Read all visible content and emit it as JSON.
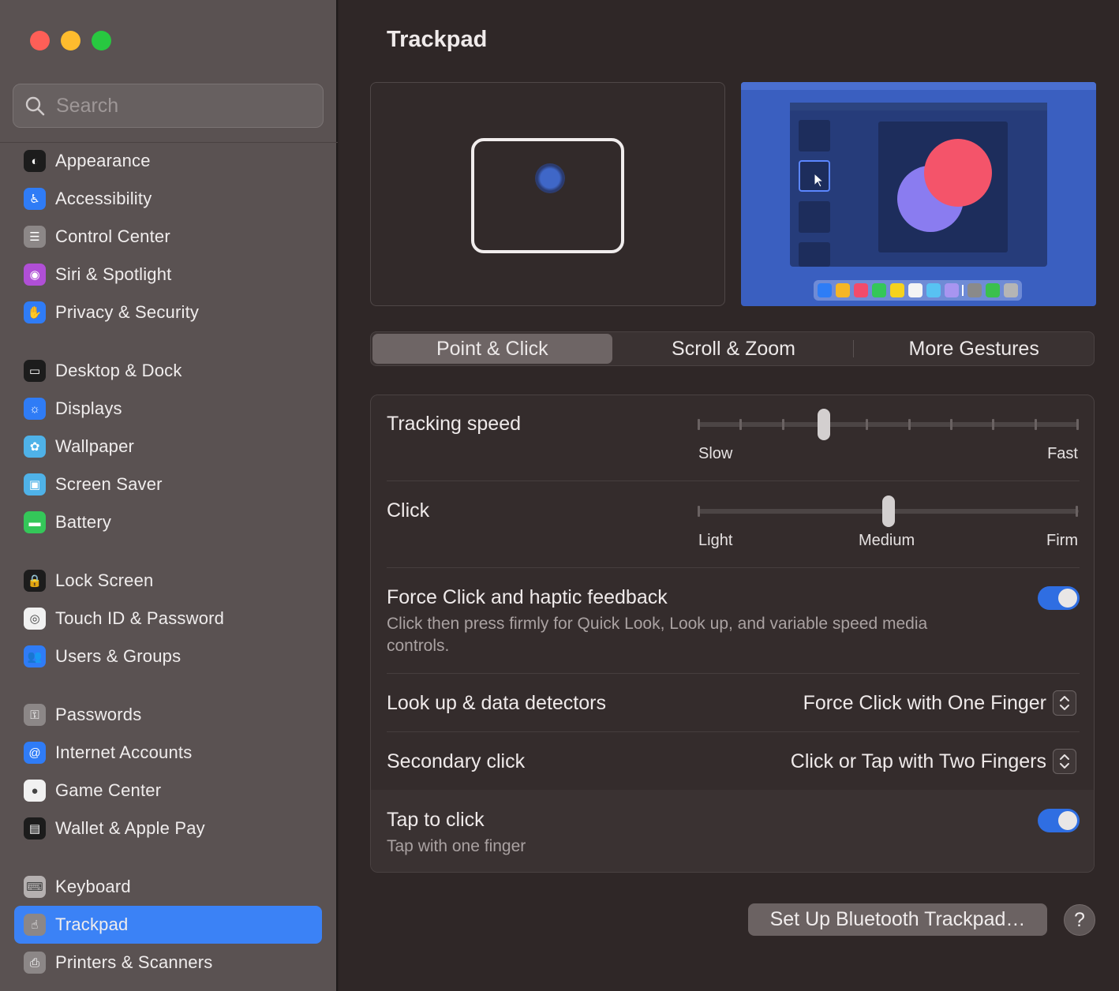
{
  "window": {
    "title": "Trackpad"
  },
  "search": {
    "placeholder": "Search"
  },
  "sidebar": {
    "items": [
      {
        "label": "Appearance",
        "icon": "appearance-icon",
        "color": "#1c1c1c"
      },
      {
        "label": "Accessibility",
        "icon": "accessibility-icon",
        "color": "#2f7cf6"
      },
      {
        "label": "Control Center",
        "icon": "control-center-icon",
        "color": "#8c8787"
      },
      {
        "label": "Siri & Spotlight",
        "icon": "siri-icon",
        "color": "#b04fd6"
      },
      {
        "label": "Privacy & Security",
        "icon": "hand-icon",
        "color": "#2f7cf6"
      },
      {
        "label": "Desktop & Dock",
        "icon": "dock-icon",
        "color": "#1c1c1c"
      },
      {
        "label": "Displays",
        "icon": "sun-icon",
        "color": "#2f7cf6"
      },
      {
        "label": "Wallpaper",
        "icon": "flower-icon",
        "color": "#4fb2e8"
      },
      {
        "label": "Screen Saver",
        "icon": "screen-saver-icon",
        "color": "#4fb2e8"
      },
      {
        "label": "Battery",
        "icon": "battery-icon",
        "color": "#34c759"
      },
      {
        "label": "Lock Screen",
        "icon": "lock-icon",
        "color": "#1c1c1c"
      },
      {
        "label": "Touch ID & Password",
        "icon": "fingerprint-icon",
        "color": "#f1f1f1"
      },
      {
        "label": "Users & Groups",
        "icon": "users-icon",
        "color": "#2f7cf6"
      },
      {
        "label": "Passwords",
        "icon": "key-icon",
        "color": "#8c8787"
      },
      {
        "label": "Internet Accounts",
        "icon": "at-icon",
        "color": "#2f7cf6"
      },
      {
        "label": "Game Center",
        "icon": "game-center-icon",
        "color": "#f1f1f1"
      },
      {
        "label": "Wallet & Apple Pay",
        "icon": "wallet-icon",
        "color": "#1c1c1c"
      },
      {
        "label": "Keyboard",
        "icon": "keyboard-icon",
        "color": "#b5b0b0"
      },
      {
        "label": "Trackpad",
        "icon": "trackpad-icon",
        "color": "#8c8787"
      },
      {
        "label": "Printers & Scanners",
        "icon": "printer-icon",
        "color": "#8c8787"
      }
    ],
    "active_item": "Trackpad"
  },
  "tabs": [
    {
      "label": "Point & Click",
      "active": true
    },
    {
      "label": "Scroll & Zoom",
      "active": false
    },
    {
      "label": "More Gestures",
      "active": false
    }
  ],
  "settings": {
    "tracking": {
      "label": "Tracking speed",
      "min_label": "Slow",
      "max_label": "Fast",
      "level": 0.33
    },
    "click": {
      "label": "Click",
      "labels": [
        "Light",
        "Medium",
        "Firm"
      ],
      "level": 0.5
    },
    "force_click": {
      "label": "Force Click and haptic feedback",
      "description": "Click then press firmly for Quick Look, Look up, and variable speed media controls.",
      "enabled": true
    },
    "lookup": {
      "label": "Look up & data detectors",
      "value": "Force Click with One Finger"
    },
    "secondary": {
      "label": "Secondary click",
      "value": "Click or Tap with Two Fingers"
    },
    "tap": {
      "label": "Tap to click",
      "description": "Tap with one finger",
      "enabled": true
    }
  },
  "buttons": {
    "bluetooth": "Set Up Bluetooth Trackpad…",
    "help": "?"
  },
  "colors": {
    "accent": "#2f6ee2",
    "sidebar_active": "#3b82f6"
  }
}
